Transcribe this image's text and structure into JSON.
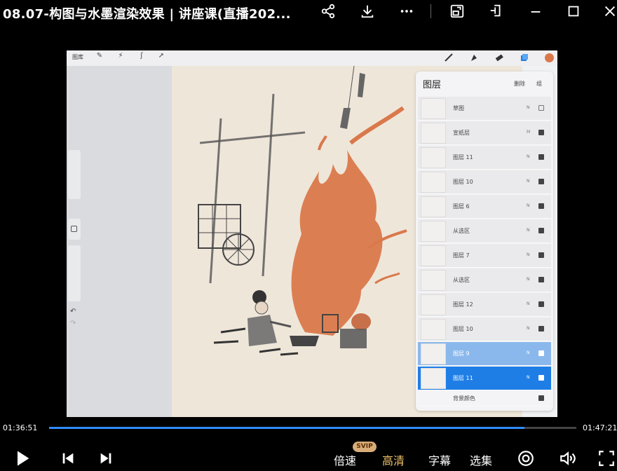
{
  "window": {
    "title": "08.07-构图与水墨渲染效果 | 讲座课(直播202...",
    "icons": [
      "share-icon",
      "download-icon",
      "more-icon",
      "picture-in-picture-icon",
      "pin-icon",
      "minimize-icon",
      "maximize-icon",
      "close-icon"
    ]
  },
  "procreate": {
    "toolbar": {
      "gallery_label": "图库"
    },
    "layers_panel": {
      "title": "图层",
      "delete_label": "删除",
      "group_label": "组",
      "layers": [
        {
          "name": "草图",
          "mode": "N",
          "visible": false,
          "state": "normal"
        },
        {
          "name": "宣纸层",
          "mode": "M",
          "visible": true,
          "state": "normal"
        },
        {
          "name": "图层 11",
          "mode": "N",
          "visible": true,
          "state": "normal"
        },
        {
          "name": "图层 10",
          "mode": "N",
          "visible": true,
          "state": "normal"
        },
        {
          "name": "图层 6",
          "mode": "N",
          "visible": true,
          "state": "normal"
        },
        {
          "name": "从选区",
          "mode": "N",
          "visible": true,
          "state": "normal"
        },
        {
          "name": "图层 7",
          "mode": "N",
          "visible": true,
          "state": "normal"
        },
        {
          "name": "从选区",
          "mode": "N",
          "visible": true,
          "state": "normal"
        },
        {
          "name": "图层 12",
          "mode": "N",
          "visible": true,
          "state": "normal"
        },
        {
          "name": "图层 10",
          "mode": "N",
          "visible": true,
          "state": "normal"
        },
        {
          "name": "图层 9",
          "mode": "N",
          "visible": true,
          "state": "secondary-selected"
        },
        {
          "name": "图层 11",
          "mode": "N",
          "visible": true,
          "state": "selected"
        },
        {
          "name": "背景颜色",
          "mode": "",
          "visible": true,
          "state": "background"
        }
      ]
    },
    "colors": {
      "brush_color": "#d9794b",
      "paper": "#efe6da",
      "active_blue": "#1e7ee6"
    }
  },
  "player": {
    "current_time": "01:36:51",
    "total_time": "01:47:21",
    "progress": 0.902,
    "speed_label": "倍速",
    "svip_badge": "SVIP",
    "quality_label": "高清",
    "subtitle_label": "字幕",
    "episodes_label": "选集",
    "colors": {
      "progress": "#2f8cff",
      "quality": "#f0c36e"
    }
  }
}
